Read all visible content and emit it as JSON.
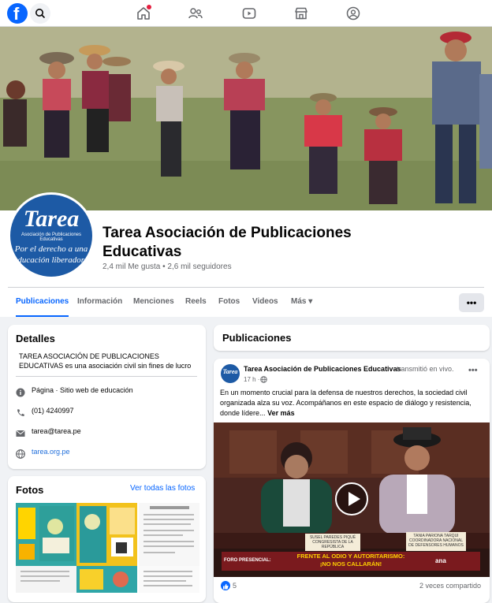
{
  "colors": {
    "brand": "#0866ff",
    "link": "#216fdb",
    "page_bg": "#f0f2f5",
    "avatar_blue": "#1d5aa5",
    "banner_red": "#7a1a1e",
    "banner_yellow": "#ffd100"
  },
  "topnav": {
    "logo_letter": "f",
    "icons": [
      "facebook-logo-icon",
      "search-icon",
      "home-icon",
      "friends-icon",
      "watch-icon",
      "marketplace-icon",
      "groups-icon"
    ]
  },
  "profile": {
    "avatar_brand": "Tarea",
    "avatar_subtitle": "Asociación de Publicaciones Educativas",
    "avatar_motto": "Por el derecho a una educación liberadora",
    "name": "Tarea Asociación de Publicaciones Educativas",
    "stats": "2,4 mil Me gusta • 2,6 mil seguidores"
  },
  "tabs": [
    {
      "label": "Publicaciones",
      "active": true
    },
    {
      "label": "Información",
      "active": false
    },
    {
      "label": "Menciones",
      "active": false
    },
    {
      "label": "Reels",
      "active": false
    },
    {
      "label": "Fotos",
      "active": false
    },
    {
      "label": "Videos",
      "active": false
    },
    {
      "label": "Más ▾",
      "active": false
    }
  ],
  "tabs_more_button": "•••",
  "details": {
    "title": "Detalles",
    "description": "TAREA ASOCIACIÓN DE PUBLICACIONES EDUCATIVAS es una asociación civil sin fines de lucro fundada en en",
    "rows": [
      {
        "icon": "info-icon",
        "text": "Página · Sitio web de educación",
        "bold_prefix": "Página"
      },
      {
        "icon": "phone-icon",
        "text": "(01) 4240997"
      },
      {
        "icon": "mail-icon",
        "text": "tarea@tarea.pe"
      },
      {
        "icon": "globe-icon",
        "text": "tarea.org.pe"
      }
    ]
  },
  "photos": {
    "title": "Fotos",
    "see_all": "Ver todas las fotos"
  },
  "posts_section": {
    "title": "Publicaciones"
  },
  "post": {
    "author": "Tarea Asociación de Publicaciones Educativas",
    "action": "transmitió en vivo.",
    "time": "17 h ·",
    "text": "En un momento crucial para la defensa de nuestros derechos, la sociedad civil organizada alza su voz. Acompáñanos en este espacio de diálogo y resistencia, donde lídere...",
    "see_more": "Ver más",
    "video": {
      "nameplate_left_name": "SUSEL PAREDES PIQUÉ",
      "nameplate_left_role": "CONGRESISTA DE LA REPÚBLICA",
      "nameplate_right_name": "TANIA PARIONA TARQUI",
      "nameplate_right_role": "COORDINADORA NACIONAL DE DEFENSORES HUMANOS",
      "banner_left": "FORO PRESENCIAL:",
      "banner_main_1": "FRENTE AL ODIO Y AUTORITARISMO:",
      "banner_main_2": "¡NO NOS CALLARÁN!",
      "banner_logo": "ana"
    },
    "likes": "5",
    "shares": "2 veces compartido"
  }
}
